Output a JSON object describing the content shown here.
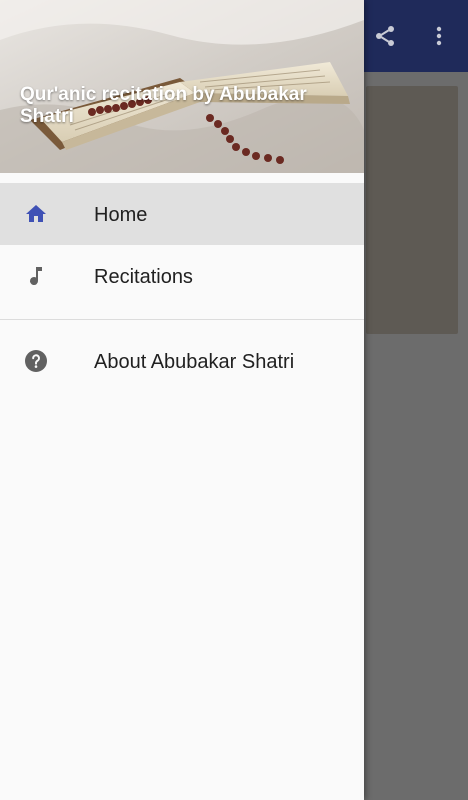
{
  "drawer": {
    "header_title": "Qur'anic recitation by Abubakar Shatri",
    "items": [
      {
        "label": "Home",
        "icon": "home-icon",
        "active": true
      },
      {
        "label": "Recitations",
        "icon": "music-note-icon",
        "active": false
      }
    ],
    "secondary_items": [
      {
        "label": "About Abubakar Shatri",
        "icon": "help-icon"
      }
    ]
  },
  "app_bar": {
    "actions": [
      "share-icon",
      "more-vert-icon"
    ],
    "color": "#1f2a5a"
  },
  "colors": {
    "active_icon": "#3f51b5",
    "inactive_icon": "#616161",
    "active_bg": "#e0e0e0"
  }
}
